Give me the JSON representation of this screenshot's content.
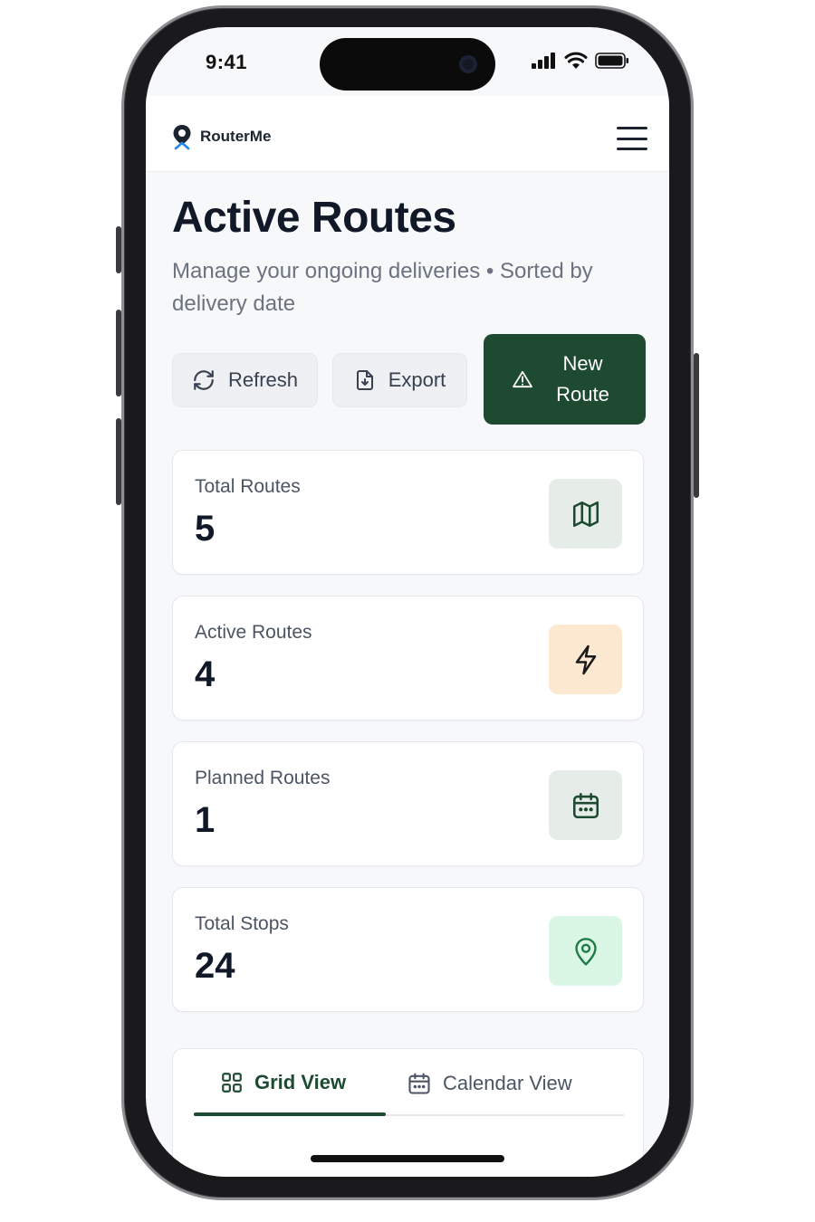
{
  "status_bar": {
    "time": "9:41"
  },
  "header": {
    "app_name": "RouterMe"
  },
  "page": {
    "title": "Active Routes",
    "subtitle": "Manage your ongoing deliveries • Sorted by delivery date"
  },
  "actions": {
    "refresh_label": "Refresh",
    "export_label": "Export",
    "new_route_label": "New Route"
  },
  "stats": [
    {
      "label": "Total Routes",
      "value": "5",
      "icon": "map-icon",
      "icon_bg": "#e6ede8",
      "icon_color": "#1e4a32"
    },
    {
      "label": "Active Routes",
      "value": "4",
      "icon": "lightning-icon",
      "icon_bg": "#fde8d2",
      "icon_color": "#1a1a1a"
    },
    {
      "label": "Planned Routes",
      "value": "1",
      "icon": "calendar-icon",
      "icon_bg": "#e6ede8",
      "icon_color": "#1e4a32"
    },
    {
      "label": "Total Stops",
      "value": "24",
      "icon": "map-pin-icon",
      "icon_bg": "#d9f7e4",
      "icon_color": "#1e7a45"
    }
  ],
  "tabs": [
    {
      "label": "Grid View",
      "icon": "grid-icon",
      "active": true
    },
    {
      "label": "Calendar View",
      "icon": "calendar-icon",
      "active": false
    }
  ],
  "colors": {
    "brand": "#1e4a32",
    "brand_text": "#ffffff",
    "logo_blue": "#1e88e5"
  }
}
